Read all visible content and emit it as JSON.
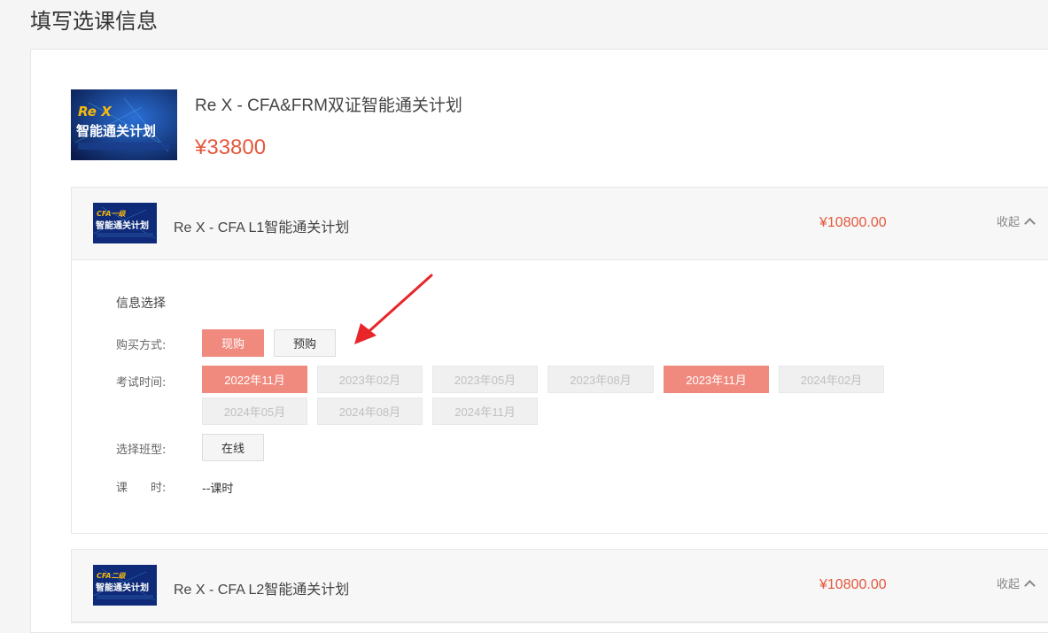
{
  "page": {
    "title": "填写选课信息"
  },
  "package": {
    "thumb_text_1": "Re X",
    "thumb_text_2": "智能通关计划",
    "title": "Re X - CFA&FRM双证智能通关计划",
    "price": "¥33800"
  },
  "courses": [
    {
      "thumb_text_1": "CFA一级",
      "thumb_text_2": "智能通关计划",
      "name": "Re X - CFA L1智能通关计划",
      "price": "¥10800.00",
      "collapse_label": "收起",
      "info": {
        "section_title": "信息选择",
        "purchase_label": "购买方式:",
        "purchase_options": [
          "现购",
          "预购"
        ],
        "exam_label": "考试时间:",
        "exam_options": [
          "2022年11月",
          "2023年02月",
          "2023年05月",
          "2023年08月",
          "2023年11月",
          "2024年02月",
          "2024年05月",
          "2024年08月",
          "2024年11月"
        ],
        "class_label": "选择班型:",
        "class_options": [
          "在线"
        ],
        "hours_label": "课　　时:",
        "hours_value": "--课时"
      }
    },
    {
      "thumb_text_1": "CFA二级",
      "thumb_text_2": "智能通关计划",
      "name": "Re X - CFA L2智能通关计划",
      "price": "¥10800.00",
      "collapse_label": "收起"
    }
  ],
  "colors": {
    "accent": "#f08a7e",
    "price": "#e4573b",
    "arrow": "#e8262a"
  }
}
